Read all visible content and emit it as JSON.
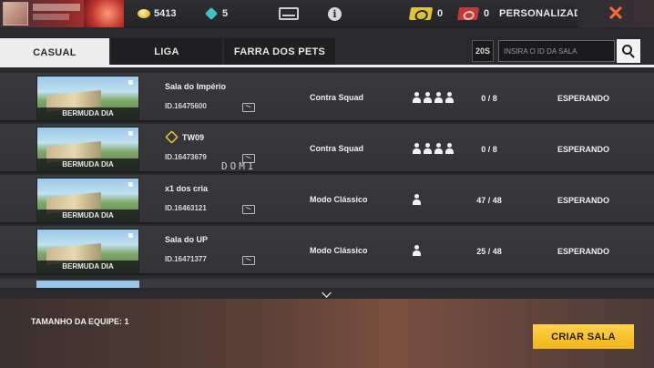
{
  "topbar": {
    "gold": "5413",
    "diamonds": "5",
    "ticket_a": "0",
    "ticket_b": "0",
    "mode": "PERSONALIZADA"
  },
  "tabs": [
    {
      "label": "CASUAL",
      "active": true
    },
    {
      "label": "LIGA",
      "active": false
    },
    {
      "label": "FARRA DOS PETS",
      "active": false
    }
  ],
  "search": {
    "count": "20S",
    "placeholder": "INSIRA O ID DA SALA"
  },
  "rooms": [
    {
      "map": "BERMUDA DIA",
      "name": "Sala do Império",
      "id": "ID.16475600",
      "mode": "Contra Squad",
      "players_icons": 4,
      "count": "0 / 8",
      "status": "ESPERANDO"
    },
    {
      "map": "BERMUDA DIA",
      "name": "TW09",
      "id": "ID.16473679",
      "mode": "Contra Squad",
      "players_icons": 4,
      "count": "0 / 8",
      "status": "ESPERANDO"
    },
    {
      "map": "BERMUDA DIA",
      "name": "x1 dos cria",
      "id": "ID.16463121",
      "mode": "Modo Clássico",
      "players_icons": 1,
      "count": "47 / 48",
      "status": "ESPERANDO"
    },
    {
      "map": "BERMUDA DIA",
      "name": "Sala do UP",
      "id": "ID.16471377",
      "mode": "Modo Clássico",
      "players_icons": 1,
      "count": "25 / 48",
      "status": "ESPERANDO"
    }
  ],
  "overlay": "DOMI",
  "footer": {
    "team_size": "TAMANHO DA EQUIPE: 1",
    "create_label": "CRIAR SALA"
  },
  "colors": {
    "accent": "#f2b418",
    "close": "#ff6a2a"
  }
}
